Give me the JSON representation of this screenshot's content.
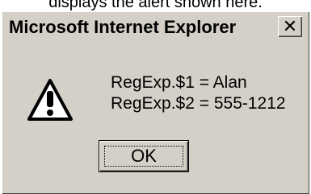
{
  "top_text": "displays the alert shown here.",
  "dialog": {
    "title": "Microsoft Internet Explorer",
    "close_label": "✕",
    "icon": "warning-icon",
    "message_lines": [
      "RegExp.$1 = Alan",
      "RegExp.$2 = 555-1212"
    ],
    "ok_label": "OK"
  },
  "colors": {
    "dialog_bg": "#d4d0c8",
    "warning_fill": "#ffffff",
    "warning_outline": "#000000"
  }
}
